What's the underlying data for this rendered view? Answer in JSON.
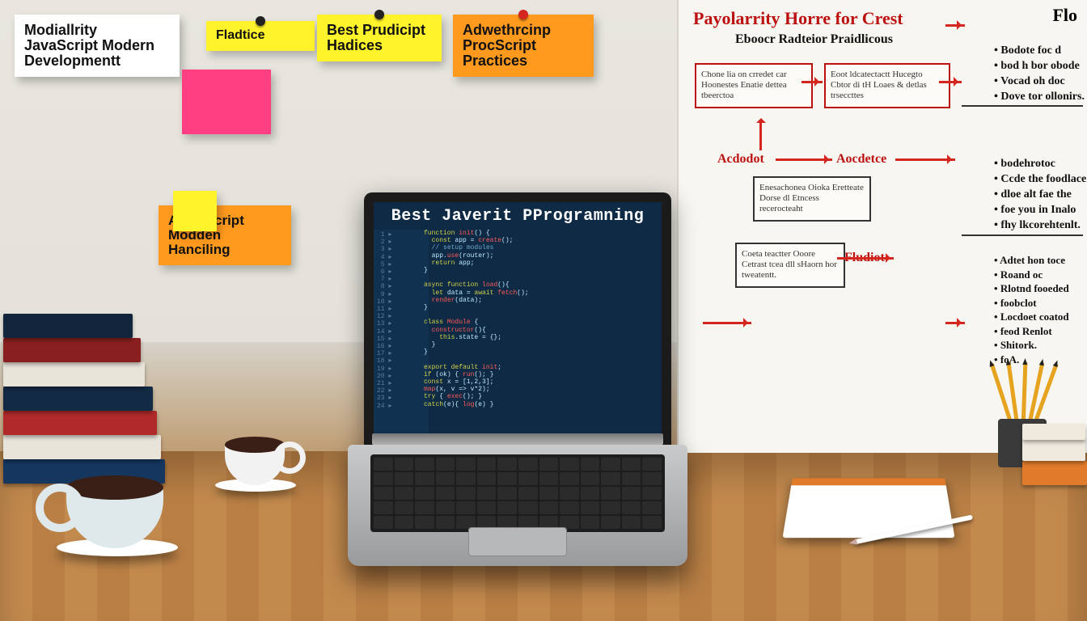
{
  "notes": {
    "n1": "Modiallrity\nJavaScript\nModern\nDevelopmentt",
    "n2": "Fladtice",
    "n3": "Best\nPrudicipt\nHadices",
    "n4": "Adwethrcinp\nProcScript\nPractices",
    "n5": "Avdarscript\nModden\nHanciling"
  },
  "whiteboard": {
    "title": "Payolarrity  Horre for Crest",
    "subtitle": "Eboocr  Radteior  Praidlicous",
    "flo": "Flo",
    "labels": {
      "a": "Acdodot",
      "b": "Aocdetce",
      "c": "Fludiot"
    },
    "box1": "Chone lia on crredet\ncar  Hoonestes\nEnatie dettea tbeerctoa",
    "box2": "Eoot  ldcatectactt\nHucegto  Cbtor di tH\nLoaes & detlas trseccttes",
    "box3": "Enesachonea\nOioka  Eretteate\nDorse dl Etncess\nrecerocteaht",
    "box4": "Coeta teactter\nOoore  Cetrast\ntcea dll sHaorn\nhor tweatentt.",
    "list1": [
      "Bodote foc d",
      "bod h bor obode",
      "Vocad oh doc",
      "Dove tor ollonirs."
    ],
    "list2": [
      "bodehrotoc",
      "Ccde the foodlace",
      "dloe alt fae the",
      "foe you in Inalo",
      "fhy lkcorehtenlt."
    ],
    "list3": [
      "Adtet hon toce",
      "Roand oc",
      "Rlotnd fooeded",
      "foobclot",
      "Locdoet coatod",
      "feod Renlot",
      "Shitork.",
      "foA."
    ]
  },
  "laptop": {
    "title": "Best Javerit PProgramning",
    "code_lines": [
      "function init() {",
      "  const app = create();",
      "  // setup modules",
      "  app.use(router);",
      "  return app;",
      "}",
      "",
      "async function load(){",
      "  let data = await fetch();",
      "  render(data);",
      "}",
      "",
      "class Module {",
      "  constructor(){",
      "    this.state = {};",
      "  }",
      "}",
      "",
      "export default init;",
      "if (ok) { run(); }",
      "const x = [1,2,3];",
      "map(x, v => v*2);",
      "try { exec(); }",
      "catch(e){ log(e) }"
    ]
  }
}
